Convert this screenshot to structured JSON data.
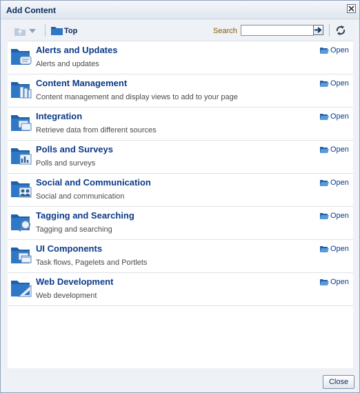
{
  "dialog": {
    "title": "Add Content"
  },
  "toolbar": {
    "location_label": "Top",
    "search_label": "Search",
    "search_value": "",
    "search_placeholder": ""
  },
  "items": [
    {
      "title": "Alerts and Updates",
      "description": "Alerts and updates",
      "open_label": "Open",
      "icon": "alerts-folder-icon"
    },
    {
      "title": "Content Management",
      "description": "Content management and display views to add to your page",
      "open_label": "Open",
      "icon": "content-folder-icon"
    },
    {
      "title": "Integration",
      "description": "Retrieve data from different sources",
      "open_label": "Open",
      "icon": "integration-folder-icon"
    },
    {
      "title": "Polls and Surveys",
      "description": "Polls and surveys",
      "open_label": "Open",
      "icon": "polls-folder-icon"
    },
    {
      "title": "Social and Communication",
      "description": "Social and communication",
      "open_label": "Open",
      "icon": "social-folder-icon"
    },
    {
      "title": "Tagging and Searching",
      "description": "Tagging and searching",
      "open_label": "Open",
      "icon": "tagging-folder-icon"
    },
    {
      "title": "UI Components",
      "description": "Task flows, Pagelets and Portlets",
      "open_label": "Open",
      "icon": "ui-components-folder-icon"
    },
    {
      "title": "Web Development",
      "description": "Web development",
      "open_label": "Open",
      "icon": "web-dev-folder-icon"
    }
  ],
  "footer": {
    "close_label": "Close"
  },
  "colors": {
    "title": "#0b2a5a",
    "link": "#0b3a88",
    "folder": "#1f5fa8"
  }
}
